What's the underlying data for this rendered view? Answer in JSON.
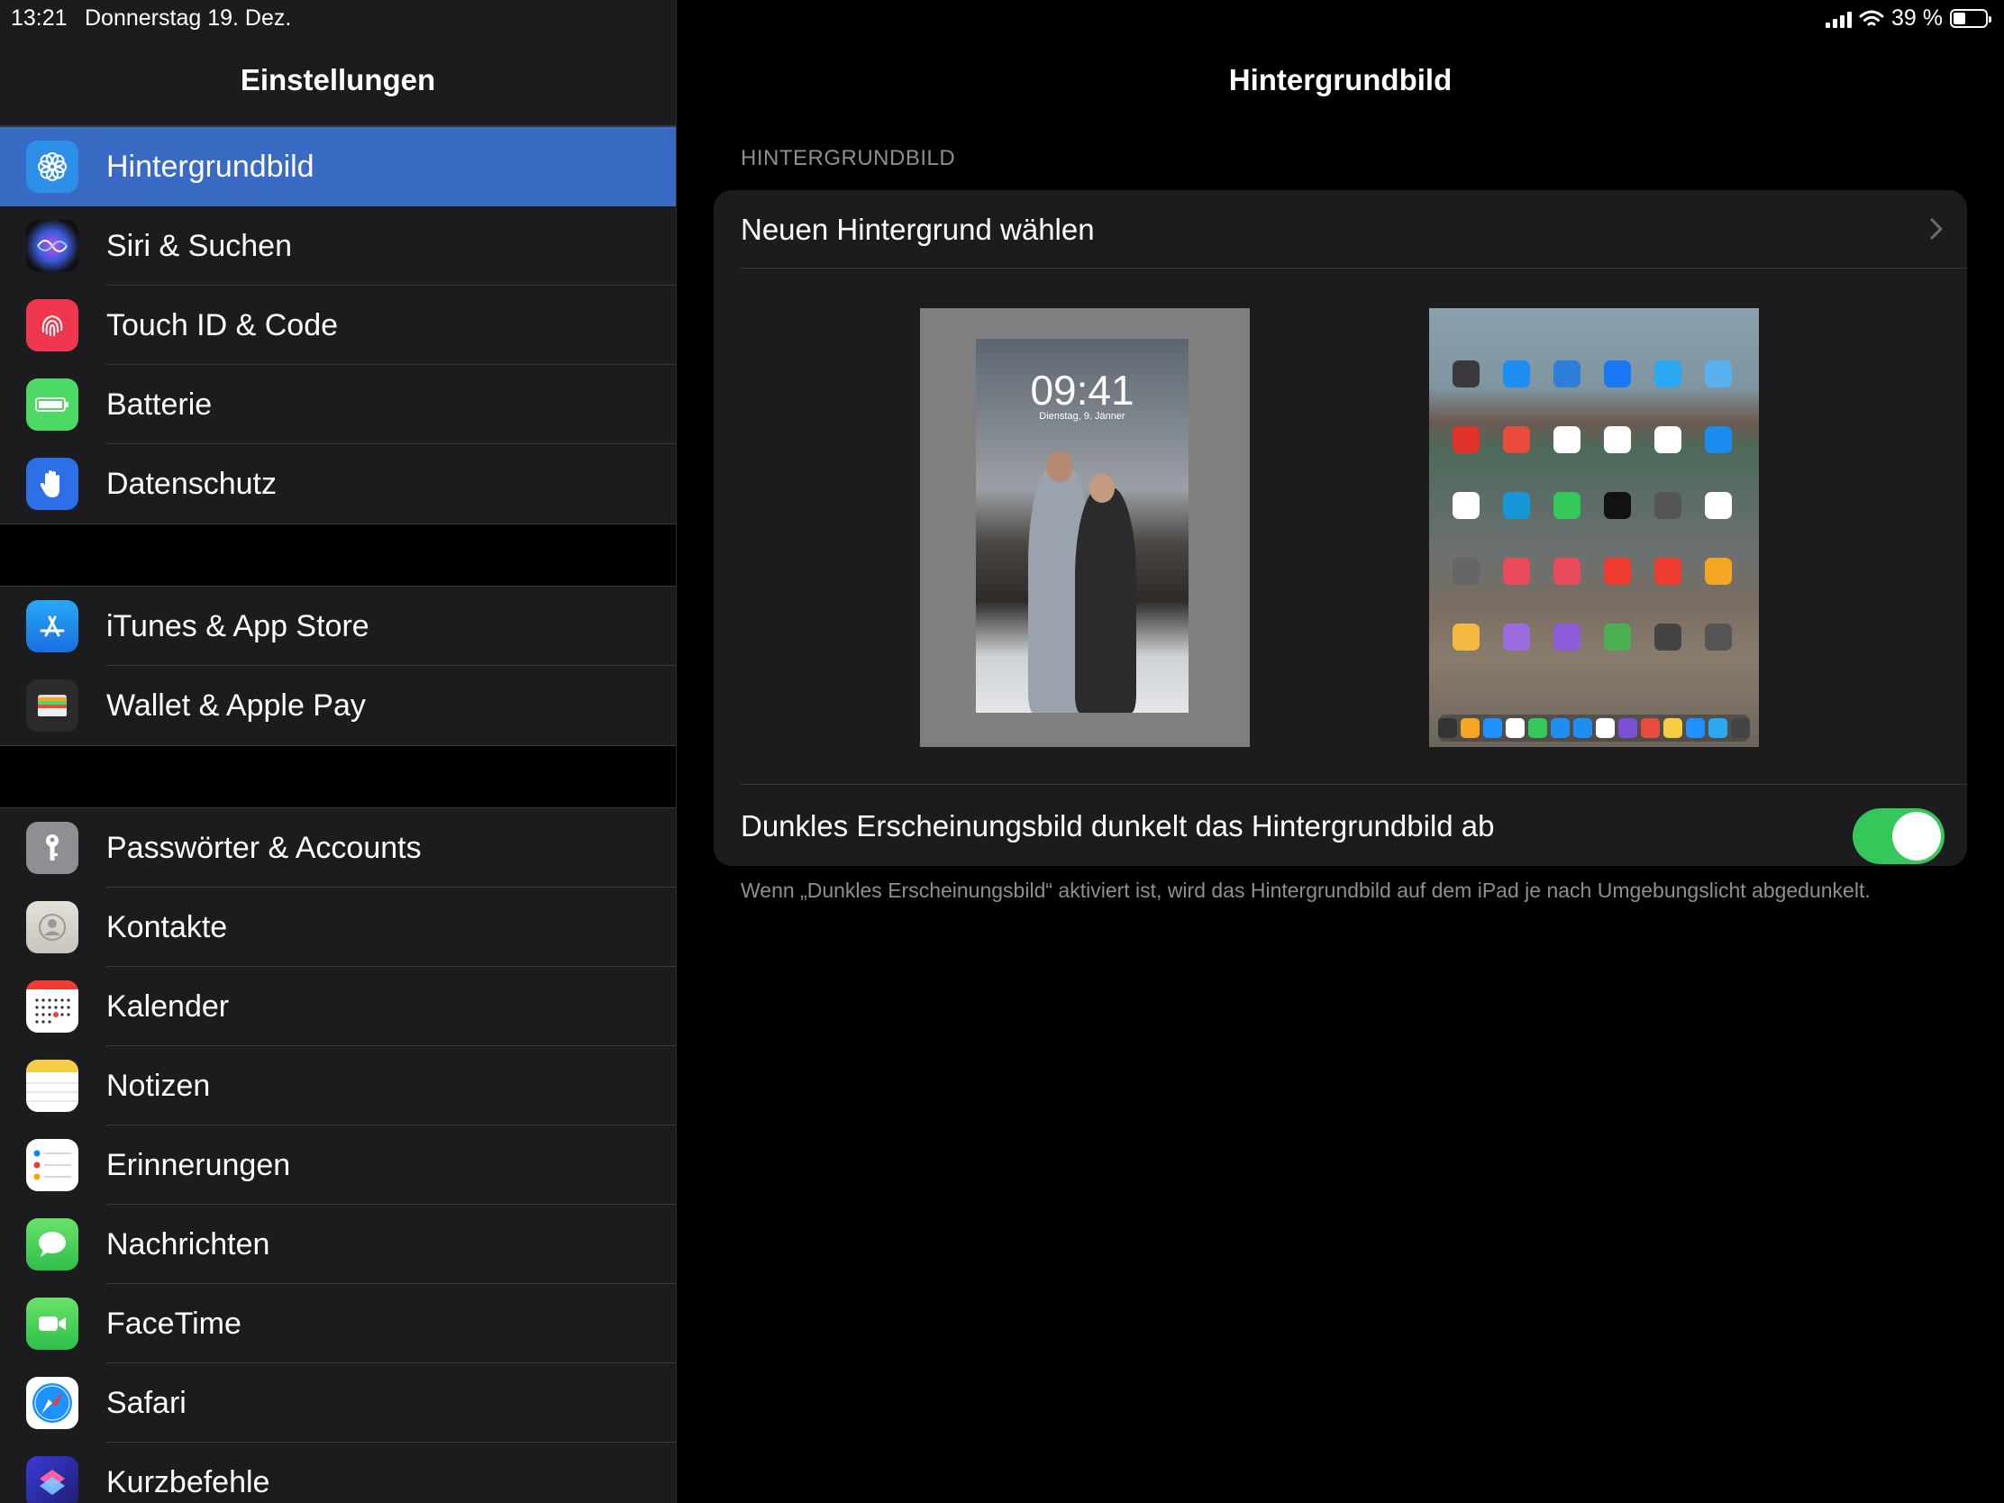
{
  "status": {
    "time": "13:21",
    "date": "Donnerstag 19. Dez.",
    "battery_text": "39 %",
    "battery_level": 0.39
  },
  "sidebar": {
    "title": "Einstellungen",
    "items": [
      {
        "label": "Hintergrundbild",
        "icon": "wallpaper-icon",
        "color": "#2e8fe8",
        "selected": true
      },
      {
        "label": "Siri & Suchen",
        "icon": "siri-icon",
        "color": "#1a1a2e"
      },
      {
        "label": "Touch ID & Code",
        "icon": "fingerprint-icon",
        "color": "#f0374f"
      },
      {
        "label": "Batterie",
        "icon": "battery-icon",
        "color": "#4cd964"
      },
      {
        "label": "Datenschutz",
        "icon": "hand-icon",
        "color": "#2c6fe8"
      },
      {
        "label": "iTunes & App Store",
        "icon": "app-store-icon",
        "color": "#1d8ef2"
      },
      {
        "label": "Wallet & Apple Pay",
        "icon": "wallet-icon",
        "color": "#2b2b2b"
      },
      {
        "label": "Passwörter & Accounts",
        "icon": "key-icon",
        "color": "#8e8e93"
      },
      {
        "label": "Kontakte",
        "icon": "contacts-icon",
        "color": "#d4d0ca"
      },
      {
        "label": "Kalender",
        "icon": "calendar-icon",
        "color": "#ffffff"
      },
      {
        "label": "Notizen",
        "icon": "notes-icon",
        "color": "#ffffff"
      },
      {
        "label": "Erinnerungen",
        "icon": "reminders-icon",
        "color": "#ffffff"
      },
      {
        "label": "Nachrichten",
        "icon": "messages-icon",
        "color": "#4cd964"
      },
      {
        "label": "FaceTime",
        "icon": "facetime-icon",
        "color": "#4cd964"
      },
      {
        "label": "Safari",
        "icon": "safari-icon",
        "color": "#ffffff"
      },
      {
        "label": "Kurzbefehle",
        "icon": "shortcuts-icon",
        "color": "#3b3bd9"
      }
    ]
  },
  "detail": {
    "title": "Hintergrundbild",
    "section_label": "HINTERGRUNDBILD",
    "choose_label": "Neuen Hintergrund wählen",
    "lock_preview": {
      "time": "09:41",
      "date": "Dienstag, 9. Jänner"
    },
    "toggle_label": "Dunkles Erscheinungsbild dunkelt das Hintergrundbild ab",
    "toggle_on": true,
    "footnote": "Wenn „Dunkles Erscheinungsbild“ aktiviert ist, wird das Hintergrundbild auf dem iPad je nach Umgebungslicht abgedunkelt."
  },
  "colors": {
    "accent": "#3a6bc4",
    "toggle_on": "#34c759",
    "cell": "#1c1c1e",
    "separator": "#38383a",
    "secondary_text": "#8e8e93"
  }
}
